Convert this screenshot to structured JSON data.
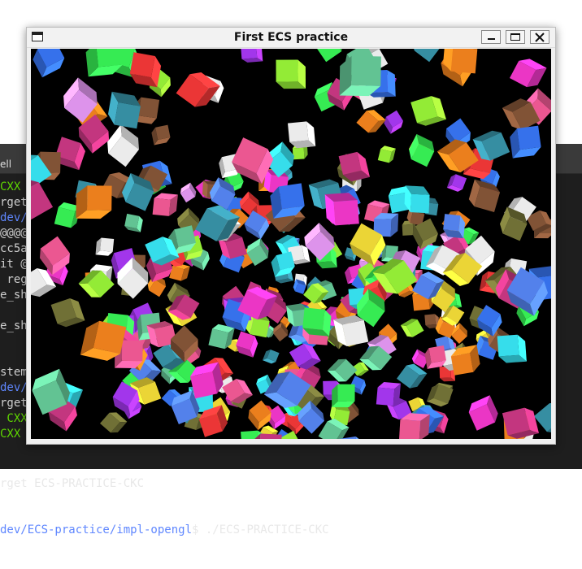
{
  "app_window": {
    "title": "First ECS practice",
    "buttons": {
      "minimize": "minimize",
      "maximize": "maximize",
      "close": "close"
    },
    "canvas_background": "#000000"
  },
  "terminal": {
    "tab_label": "ell",
    "lines": [
      {
        "text": "CXX",
        "color": "green"
      },
      {
        "text": "rget",
        "color": "white"
      },
      {
        "text": "dev/",
        "color": "blue"
      },
      {
        "text": "@@@@",
        "color": "white"
      },
      {
        "text": "cc5a",
        "color": "white"
      },
      {
        "text": "it @",
        "color": "white"
      },
      {
        "text": " reg",
        "color": "white"
      },
      {
        "text": "e_sh",
        "color": "white"
      },
      {
        "text": "",
        "color": "white"
      },
      {
        "text": "e_sh",
        "color": "white"
      },
      {
        "text": "",
        "color": "white"
      },
      {
        "text": "",
        "color": "white"
      },
      {
        "text": "stem",
        "color": "white"
      },
      {
        "text": "dev/",
        "color": "blue"
      },
      {
        "text": "rget",
        "color": "white"
      },
      {
        "text": " CXX",
        "color": "green"
      },
      {
        "text": "CXX",
        "color": "green"
      }
    ],
    "bottom_line_1": "rget ECS-PRACTICE-CKC",
    "bottom_line_2_path": "dev/ECS-practice/impl-opengl",
    "bottom_line_2_cmd": "$ ./ECS-PRACTICE-CKC"
  },
  "colors": {
    "terminal_bg": "#1e1e1e",
    "prompt_green": "#5fd700",
    "path_blue": "#5f87ff"
  }
}
